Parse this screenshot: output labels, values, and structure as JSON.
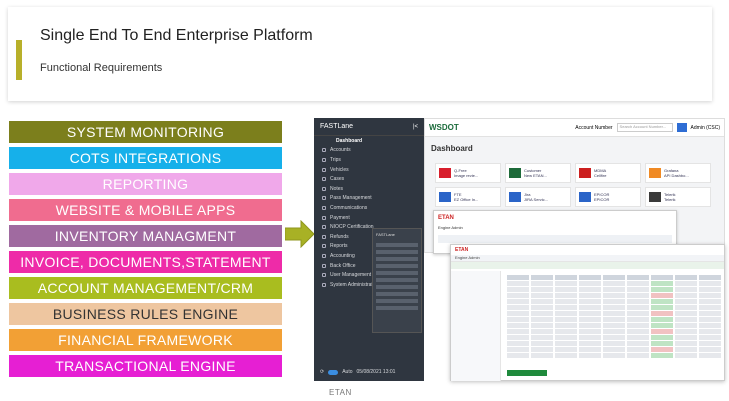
{
  "header": {
    "title": "Single End To End Enterprise Platform",
    "subtitle": "Functional Requirements",
    "accent_color": "#b8b02a"
  },
  "modules": [
    {
      "label": "SYSTEM MONITORING",
      "bg": "#7c7f1c",
      "fg": "#ffffff"
    },
    {
      "label": "COTS INTEGRATIONS",
      "bg": "#16b0ea",
      "fg": "#ffffff"
    },
    {
      "label": "REPORTING",
      "bg": "#f0a8ea",
      "fg": "#ffffff"
    },
    {
      "label": "WEBSITE & MOBILE APPS",
      "bg": "#f06c8f",
      "fg": "#ffffff"
    },
    {
      "label": "INVENTORY MANAGMENT",
      "bg": "#a06aa0",
      "fg": "#ffffff"
    },
    {
      "label": "INVOICE, DOCUMENTS,STATEMENT",
      "bg": "#ee2ba8",
      "fg": "#ffffff"
    },
    {
      "label": "ACCOUNT MANAGEMENT/CRM",
      "bg": "#a9bd1f",
      "fg": "#ffffff"
    },
    {
      "label": "BUSINESS RULES ENGINE",
      "bg": "#eec6a0",
      "fg": "#333333"
    },
    {
      "label": "FINANCIAL FRAMEWORK",
      "bg": "#f2a035",
      "fg": "#ffffff"
    },
    {
      "label": "TRANSACTIONAL ENGINE",
      "bg": "#e61fd3",
      "fg": "#ffffff"
    }
  ],
  "arrow_color": "#a8b125",
  "screens": {
    "sidebar": {
      "brand": "FASTLane",
      "items": [
        {
          "label": "Dashboard",
          "active": true
        },
        {
          "label": "Accounts"
        },
        {
          "label": "Trips"
        },
        {
          "label": "Vehicles"
        },
        {
          "label": "Cases"
        },
        {
          "label": "Notes"
        },
        {
          "label": "Pass Management"
        },
        {
          "label": "Communications"
        },
        {
          "label": "Payment"
        },
        {
          "label": "NIOCP Certification"
        },
        {
          "label": "Refunds"
        },
        {
          "label": "Reports"
        },
        {
          "label": "Accounting"
        },
        {
          "label": "Back Office"
        },
        {
          "label": "User Management"
        },
        {
          "label": "System Administration"
        }
      ],
      "footer_toggle": "Auto",
      "footer_date": "05/08/2021 13:01"
    },
    "dashboard": {
      "logo": "WSDOT",
      "account_label": "Account Number",
      "search_placeholder": "Search Account Number...",
      "user": "Admin (CSC)",
      "title": "Dashboard",
      "tiles": [
        {
          "name": "Q-Free",
          "sub": "Image revie...",
          "color": "#d81e2c"
        },
        {
          "name": "Customer",
          "sub": "New ETAN...",
          "color": "#1e6b3a"
        },
        {
          "name": "MDMA",
          "sub": "Cellfire",
          "color": "#cc1f1f"
        },
        {
          "name": "Grafana",
          "sub": "API Dashbo...",
          "color": "#f08a24"
        },
        {
          "name": "FTE",
          "sub": "EZ Office In...",
          "color": "#2a64c8"
        },
        {
          "name": "Jira",
          "sub": "JIRA Servic...",
          "color": "#2a64c8"
        },
        {
          "name": "EPICOR",
          "sub": "EPICOR",
          "color": "#2a64c8"
        },
        {
          "name": "Telerik",
          "sub": "Telerik",
          "color": "#3a3a3a"
        }
      ]
    },
    "app_panel": {
      "logo": "ETAN",
      "title": "Engine Admin"
    },
    "popup": {
      "title": "FASTLane"
    },
    "table_window": {
      "logo": "ETAN",
      "title": "Engine Admin"
    }
  },
  "caption": "ETAN"
}
